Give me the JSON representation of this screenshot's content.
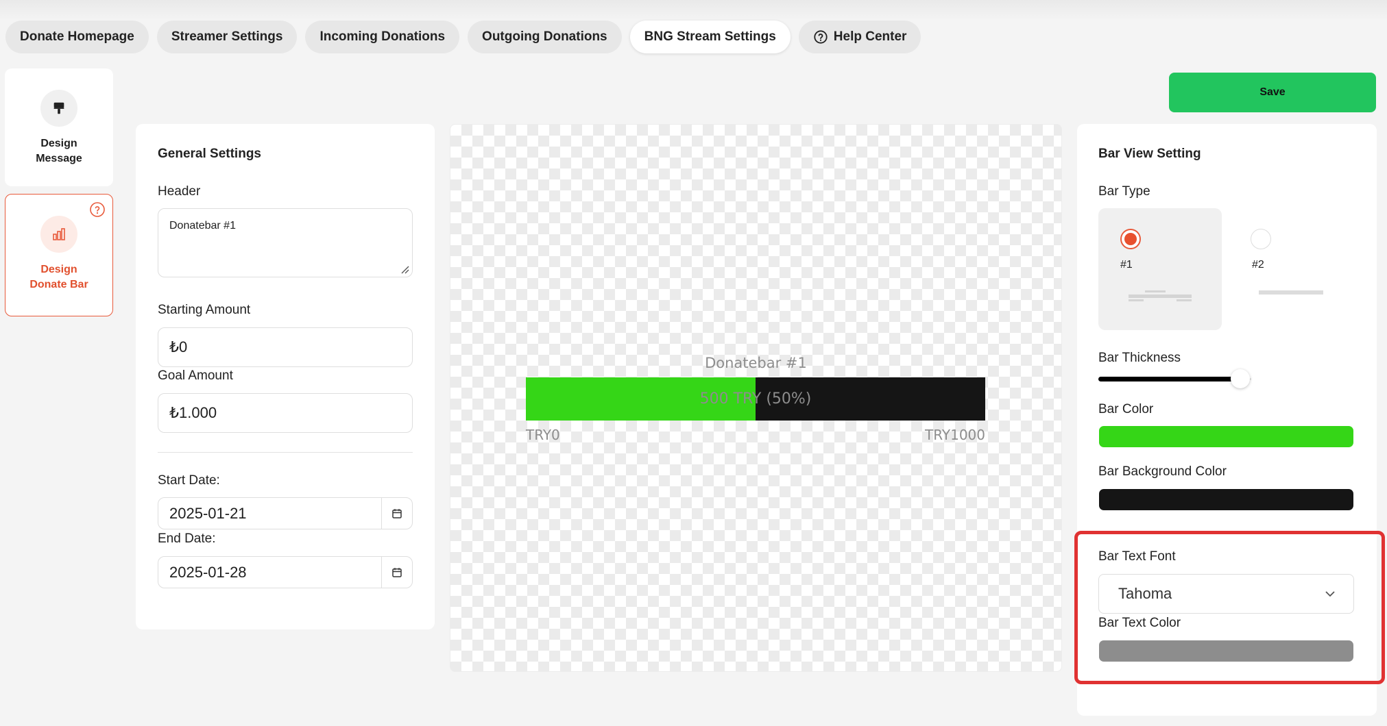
{
  "tabs": [
    {
      "label": "Donate Homepage"
    },
    {
      "label": "Streamer Settings"
    },
    {
      "label": "Incoming Donations"
    },
    {
      "label": "Outgoing Donations"
    },
    {
      "label": "BNG Stream Settings"
    },
    {
      "label": "Help Center",
      "icon": "question-circle-icon"
    }
  ],
  "active_tab": "BNG Stream Settings",
  "sidebar": {
    "items": [
      {
        "label": "Design Message",
        "icon": "paint-roller-icon"
      },
      {
        "label": "Design Donate Bar",
        "icon": "bar-chart-icon",
        "active": true
      }
    ]
  },
  "toolbar": {
    "save_label": "Save"
  },
  "general": {
    "title": "General Settings",
    "header_label": "Header",
    "header_value": "Donatebar #1",
    "starting_label": "Starting Amount",
    "starting_value": "₺0",
    "goal_label": "Goal Amount",
    "goal_value": "₺1.000",
    "start_date_label": "Start Date:",
    "start_date_value": "2025-01-21",
    "end_date_label": "End Date:",
    "end_date_value": "2025-01-28"
  },
  "preview": {
    "title": "Donatebar #1",
    "progress_text": "500 TRY (50%)",
    "progress_fraction": 0.5,
    "min_label": "TRY0",
    "max_label": "TRY1000"
  },
  "bar_view": {
    "title": "Bar View Setting",
    "type_label": "Bar Type",
    "types": [
      {
        "label": "#1",
        "selected": true
      },
      {
        "label": "#2",
        "selected": false
      }
    ],
    "thickness_label": "Bar Thickness",
    "thickness_fraction": 0.55,
    "color_label": "Bar Color",
    "color_value": "#35d617",
    "bg_color_label": "Bar Background Color",
    "bg_color_value": "#151515",
    "font_label": "Bar Text Font",
    "font_value": "Tahoma",
    "text_color_label": "Bar Text Color",
    "text_color_value": "#8d8d8d"
  },
  "colors": {
    "accent": "#e85a3b",
    "save": "#22c55e",
    "highlight": "#e03232"
  }
}
